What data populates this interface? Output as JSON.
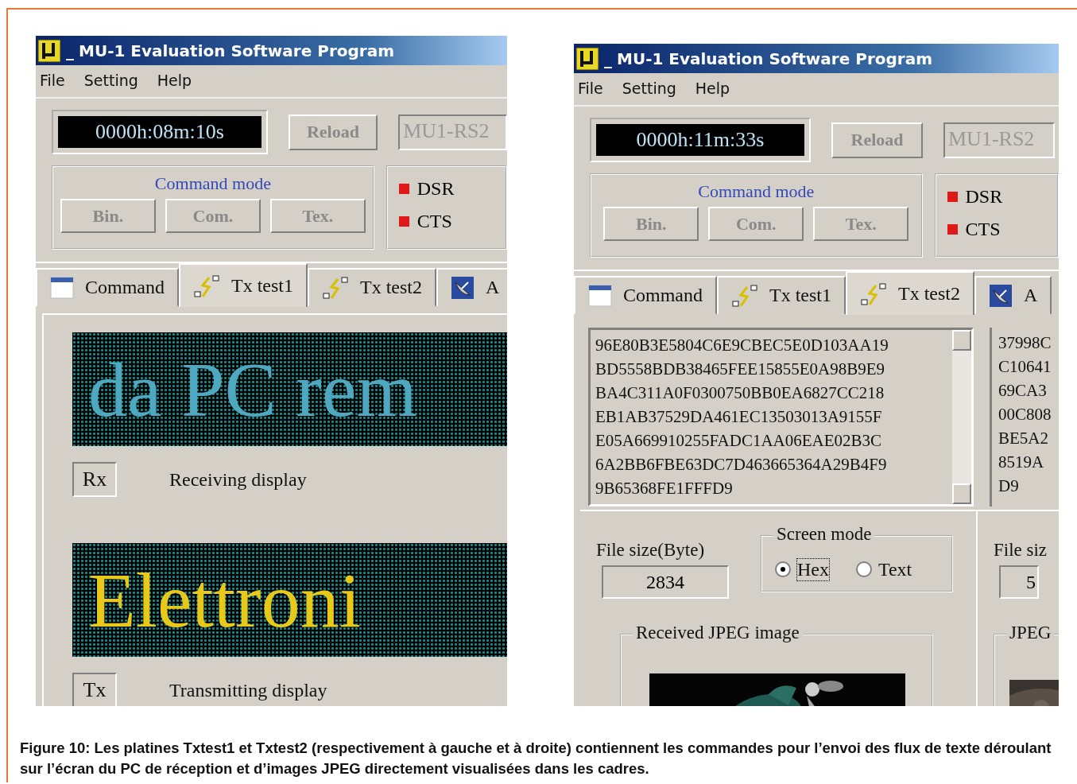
{
  "windows": [
    {
      "title": "MU-1 Evaluation Software Program",
      "title_mark": "_",
      "menu": [
        "File",
        "Setting",
        "Help"
      ],
      "timer": "0000h:08m:10s",
      "reload": {
        "label": "Reload",
        "disabled": true
      },
      "port_field": {
        "value": "MU1-RS2",
        "disabled": true
      },
      "command_mode": {
        "label": "Command mode",
        "buttons": [
          {
            "label": "Bin.",
            "disabled": true
          },
          {
            "label": "Com.",
            "disabled": true
          },
          {
            "label": "Tex.",
            "disabled": true
          }
        ]
      },
      "indicators": [
        {
          "label": "DSR",
          "on": true
        },
        {
          "label": "CTS",
          "on": true
        }
      ],
      "tabs": [
        {
          "label": "Command",
          "kind": "window",
          "selected": false
        },
        {
          "label": "Tx test1",
          "kind": "bolt",
          "selected": true
        },
        {
          "label": "Tx test2",
          "kind": "bolt",
          "selected": false
        },
        {
          "label": "A",
          "kind": "dish",
          "selected": false
        }
      ],
      "content": {
        "kind": "displays",
        "displays": [
          {
            "text": "da PC rem",
            "color": "#4fa8c0",
            "button": "Rx",
            "label": "Receiving display"
          },
          {
            "text": "Elettroni",
            "color": "#e8c818",
            "button": "Tx",
            "label": "Transmitting display"
          }
        ]
      }
    },
    {
      "title": "MU-1 Evaluation Software Program",
      "title_mark": "_",
      "menu": [
        "File",
        "Setting",
        "Help"
      ],
      "timer": "0000h:11m:33s",
      "reload": {
        "label": "Reload",
        "disabled": true
      },
      "port_field": {
        "value": "MU1-RS2",
        "disabled": true
      },
      "command_mode": {
        "label": "Command mode",
        "buttons": [
          {
            "label": "Bin.",
            "disabled": true
          },
          {
            "label": "Com.",
            "disabled": true
          },
          {
            "label": "Tex.",
            "disabled": true
          }
        ]
      },
      "indicators": [
        {
          "label": "DSR",
          "on": true
        },
        {
          "label": "CTS",
          "on": true
        }
      ],
      "tabs": [
        {
          "label": "Command",
          "kind": "window",
          "selected": false
        },
        {
          "label": "Tx test1",
          "kind": "bolt",
          "selected": false
        },
        {
          "label": "Tx test2",
          "kind": "bolt",
          "selected": true
        },
        {
          "label": "A",
          "kind": "dish",
          "selected": false
        }
      ],
      "content": {
        "kind": "jpeg",
        "hex_lines": [
          "96E80B3E5804C6E9CBEC5E0D103AA19",
          "BD5558BDB38465FEE15855E0A98B9E9",
          "BA4C311A0F0300750BB0EA6827CC218",
          "EB1AB37529DA461EC13503013A9155F",
          "E05A669910255FADC1AA06EAE02B3C",
          "6A2BB6FBE63DC7D463665364A29B4F9",
          "9B65368FE1FFFD9"
        ],
        "side_lines": [
          "37998C",
          "C10641",
          "69CA3",
          "00C808",
          "BE5A2",
          "8519A",
          "D9"
        ],
        "file_size": {
          "label": "File size(Byte)",
          "value": "2834"
        },
        "screen_mode": {
          "label": "Screen mode",
          "options": [
            {
              "label": "Hex",
              "selected": true
            },
            {
              "label": "Text",
              "selected": false
            }
          ]
        },
        "image_group": "Received JPEG image",
        "side_panel": {
          "file_size_label": "File siz",
          "file_size_value": "5",
          "image_group": "JPEG"
        }
      }
    }
  ],
  "caption": "Figure 10: Les platines Txtest1 et Txtest2 (respectivement à gauche et à droite) contiennent les commandes pour l’envoi des flux de texte déroulant sur l’écran du PC de réception et d’images JPEG directement visualisées dans les cadres."
}
